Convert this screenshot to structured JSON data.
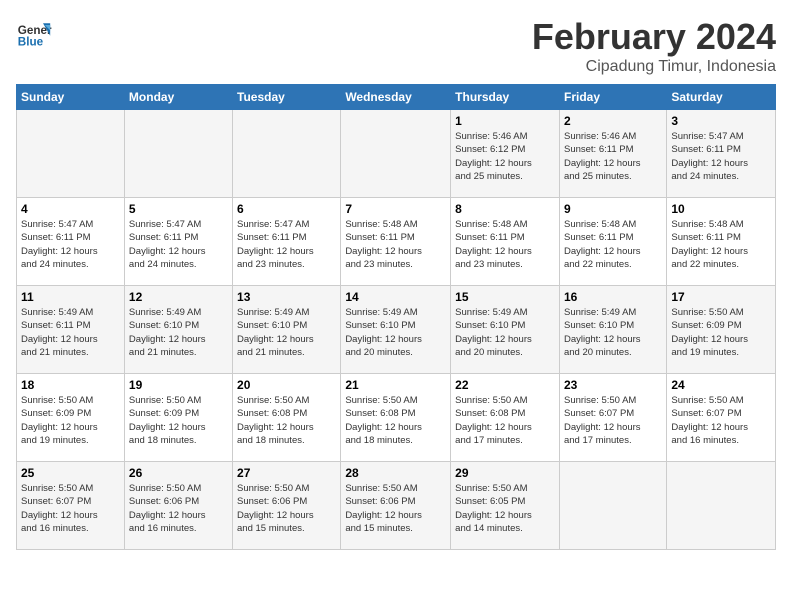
{
  "header": {
    "logo_line1": "General",
    "logo_line2": "Blue",
    "month": "February 2024",
    "location": "Cipadung Timur, Indonesia"
  },
  "weekdays": [
    "Sunday",
    "Monday",
    "Tuesday",
    "Wednesday",
    "Thursday",
    "Friday",
    "Saturday"
  ],
  "weeks": [
    [
      {
        "day": "",
        "info": ""
      },
      {
        "day": "",
        "info": ""
      },
      {
        "day": "",
        "info": ""
      },
      {
        "day": "",
        "info": ""
      },
      {
        "day": "1",
        "info": "Sunrise: 5:46 AM\nSunset: 6:12 PM\nDaylight: 12 hours\nand 25 minutes."
      },
      {
        "day": "2",
        "info": "Sunrise: 5:46 AM\nSunset: 6:11 PM\nDaylight: 12 hours\nand 25 minutes."
      },
      {
        "day": "3",
        "info": "Sunrise: 5:47 AM\nSunset: 6:11 PM\nDaylight: 12 hours\nand 24 minutes."
      }
    ],
    [
      {
        "day": "4",
        "info": "Sunrise: 5:47 AM\nSunset: 6:11 PM\nDaylight: 12 hours\nand 24 minutes."
      },
      {
        "day": "5",
        "info": "Sunrise: 5:47 AM\nSunset: 6:11 PM\nDaylight: 12 hours\nand 24 minutes."
      },
      {
        "day": "6",
        "info": "Sunrise: 5:47 AM\nSunset: 6:11 PM\nDaylight: 12 hours\nand 23 minutes."
      },
      {
        "day": "7",
        "info": "Sunrise: 5:48 AM\nSunset: 6:11 PM\nDaylight: 12 hours\nand 23 minutes."
      },
      {
        "day": "8",
        "info": "Sunrise: 5:48 AM\nSunset: 6:11 PM\nDaylight: 12 hours\nand 23 minutes."
      },
      {
        "day": "9",
        "info": "Sunrise: 5:48 AM\nSunset: 6:11 PM\nDaylight: 12 hours\nand 22 minutes."
      },
      {
        "day": "10",
        "info": "Sunrise: 5:48 AM\nSunset: 6:11 PM\nDaylight: 12 hours\nand 22 minutes."
      }
    ],
    [
      {
        "day": "11",
        "info": "Sunrise: 5:49 AM\nSunset: 6:11 PM\nDaylight: 12 hours\nand 21 minutes."
      },
      {
        "day": "12",
        "info": "Sunrise: 5:49 AM\nSunset: 6:10 PM\nDaylight: 12 hours\nand 21 minutes."
      },
      {
        "day": "13",
        "info": "Sunrise: 5:49 AM\nSunset: 6:10 PM\nDaylight: 12 hours\nand 21 minutes."
      },
      {
        "day": "14",
        "info": "Sunrise: 5:49 AM\nSunset: 6:10 PM\nDaylight: 12 hours\nand 20 minutes."
      },
      {
        "day": "15",
        "info": "Sunrise: 5:49 AM\nSunset: 6:10 PM\nDaylight: 12 hours\nand 20 minutes."
      },
      {
        "day": "16",
        "info": "Sunrise: 5:49 AM\nSunset: 6:10 PM\nDaylight: 12 hours\nand 20 minutes."
      },
      {
        "day": "17",
        "info": "Sunrise: 5:50 AM\nSunset: 6:09 PM\nDaylight: 12 hours\nand 19 minutes."
      }
    ],
    [
      {
        "day": "18",
        "info": "Sunrise: 5:50 AM\nSunset: 6:09 PM\nDaylight: 12 hours\nand 19 minutes."
      },
      {
        "day": "19",
        "info": "Sunrise: 5:50 AM\nSunset: 6:09 PM\nDaylight: 12 hours\nand 18 minutes."
      },
      {
        "day": "20",
        "info": "Sunrise: 5:50 AM\nSunset: 6:08 PM\nDaylight: 12 hours\nand 18 minutes."
      },
      {
        "day": "21",
        "info": "Sunrise: 5:50 AM\nSunset: 6:08 PM\nDaylight: 12 hours\nand 18 minutes."
      },
      {
        "day": "22",
        "info": "Sunrise: 5:50 AM\nSunset: 6:08 PM\nDaylight: 12 hours\nand 17 minutes."
      },
      {
        "day": "23",
        "info": "Sunrise: 5:50 AM\nSunset: 6:07 PM\nDaylight: 12 hours\nand 17 minutes."
      },
      {
        "day": "24",
        "info": "Sunrise: 5:50 AM\nSunset: 6:07 PM\nDaylight: 12 hours\nand 16 minutes."
      }
    ],
    [
      {
        "day": "25",
        "info": "Sunrise: 5:50 AM\nSunset: 6:07 PM\nDaylight: 12 hours\nand 16 minutes."
      },
      {
        "day": "26",
        "info": "Sunrise: 5:50 AM\nSunset: 6:06 PM\nDaylight: 12 hours\nand 16 minutes."
      },
      {
        "day": "27",
        "info": "Sunrise: 5:50 AM\nSunset: 6:06 PM\nDaylight: 12 hours\nand 15 minutes."
      },
      {
        "day": "28",
        "info": "Sunrise: 5:50 AM\nSunset: 6:06 PM\nDaylight: 12 hours\nand 15 minutes."
      },
      {
        "day": "29",
        "info": "Sunrise: 5:50 AM\nSunset: 6:05 PM\nDaylight: 12 hours\nand 14 minutes."
      },
      {
        "day": "",
        "info": ""
      },
      {
        "day": "",
        "info": ""
      }
    ]
  ]
}
